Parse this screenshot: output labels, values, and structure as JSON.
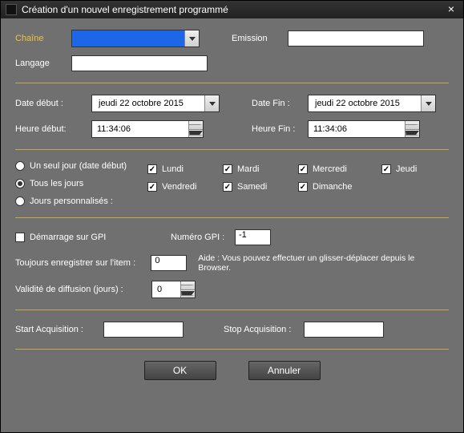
{
  "title": "Création d'un nouvel enregistrement programmé",
  "section1": {
    "chaine_label": "Chaîne",
    "chaine_value": "",
    "emission_label": "Emission",
    "emission_value": "",
    "langage_label": "Langage",
    "langage_value": ""
  },
  "section2": {
    "date_debut_label": "Date début :",
    "date_debut_value": "jeudi   22   octobre   2015",
    "date_fin_label": "Date Fin :",
    "date_fin_value": "jeudi   22   octobre   2015",
    "heure_debut_label": "Heure début:",
    "heure_debut_value": "11:34:06",
    "heure_fin_label": "Heure Fin :",
    "heure_fin_value": "11:34:06"
  },
  "section3": {
    "radios": {
      "one_day": "Un seul jour (date début)",
      "every_day": "Tous les jours",
      "custom": "Jours personnalisés :"
    },
    "days": {
      "mon": "Lundi",
      "tue": "Mardi",
      "wed": "Mercredi",
      "thu": "Jeudi",
      "fri": "Vendredi",
      "sat": "Samedi",
      "sun": "Dimanche"
    }
  },
  "section4": {
    "gpi_start_label": "Démarrage sur GPI",
    "gpi_num_label": "Numéro GPI :",
    "gpi_num_value": "-1",
    "always_item_label": "Toujours enregistrer sur l'item :",
    "always_item_value": "0",
    "help_text": "Aide : Vous pouvez effectuer un glisser-déplacer depuis le Browser.",
    "validity_label": "Validité de diffusion (jours) :",
    "validity_value": "0"
  },
  "section5": {
    "start_acq_label": "Start Acquisition :",
    "start_acq_value": "",
    "stop_acq_label": "Stop Acquisition :",
    "stop_acq_value": ""
  },
  "buttons": {
    "ok": "OK",
    "cancel": "Annuler"
  }
}
